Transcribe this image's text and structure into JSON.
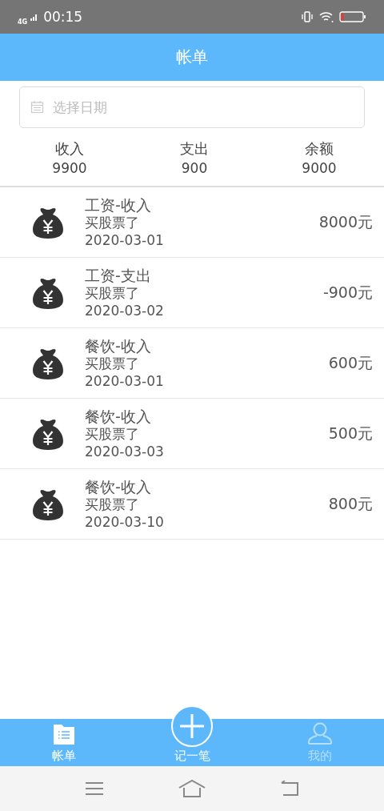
{
  "status_bar": {
    "network": "4G",
    "time": "00:15"
  },
  "header": {
    "title": "帐单"
  },
  "date_field": {
    "placeholder": "选择日期"
  },
  "summary": [
    {
      "label": "收入",
      "value": "9900"
    },
    {
      "label": "支出",
      "value": "900"
    },
    {
      "label": "余额",
      "value": "9000"
    }
  ],
  "records": [
    {
      "title": "工资-收入",
      "note": "买股票了",
      "date": "2020-03-01",
      "amount": "8000元"
    },
    {
      "title": "工资-支出",
      "note": "买股票了",
      "date": "2020-03-02",
      "amount": "-900元"
    },
    {
      "title": "餐饮-收入",
      "note": "买股票了",
      "date": "2020-03-01",
      "amount": "600元"
    },
    {
      "title": "餐饮-收入",
      "note": "买股票了",
      "date": "2020-03-03",
      "amount": "500元"
    },
    {
      "title": "餐饮-收入",
      "note": "买股票了",
      "date": "2020-03-10",
      "amount": "800元"
    }
  ],
  "tab_bar": {
    "tabs": [
      {
        "label": "帐单",
        "kind": "bills",
        "selected": true
      },
      {
        "label": "我的",
        "kind": "profile",
        "selected": false
      }
    ],
    "add_button": {
      "label": "记一笔"
    }
  }
}
